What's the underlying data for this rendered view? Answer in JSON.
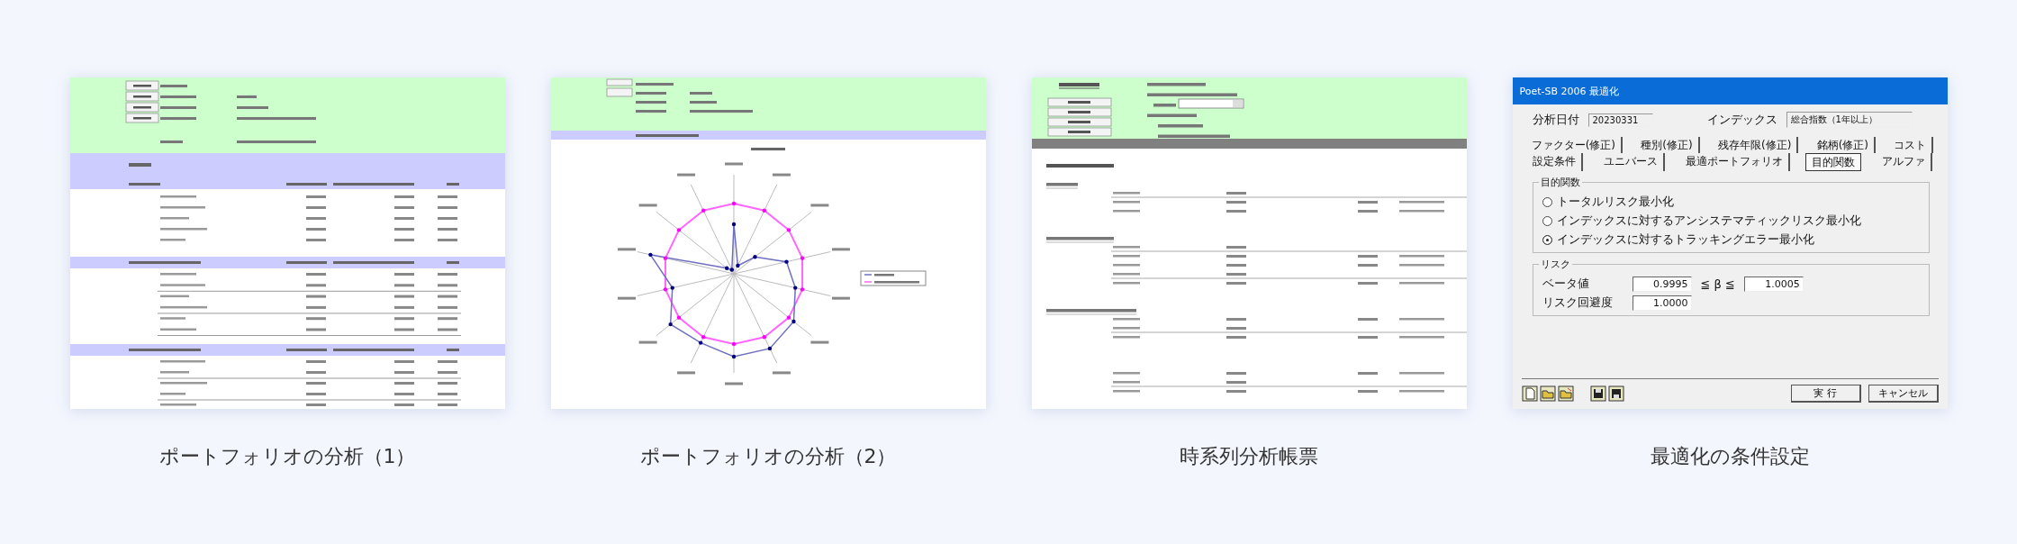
{
  "cards": [
    {
      "kind": "table-report",
      "caption": "ポートフォリオの分析（1）"
    },
    {
      "kind": "radar-report",
      "caption": "ポートフォリオの分析（2）"
    },
    {
      "kind": "timeseries-report",
      "caption": "時系列分析帳票"
    },
    {
      "kind": "dialog",
      "caption": "最適化の条件設定",
      "dialog": {
        "title": "Poet-SB 2006 最適化",
        "fields": [
          {
            "label": "分析日付",
            "value": "20230331"
          },
          {
            "label": "インデックス",
            "value": "総合指数（1年以上）"
          }
        ],
        "tab_rows": [
          [
            {
              "label": "ファクター(修正)",
              "selected": false
            },
            {
              "label": "種別(修正)",
              "selected": false
            },
            {
              "label": "残存年限(修正)",
              "selected": false
            },
            {
              "label": "銘柄(修正)",
              "selected": false
            },
            {
              "label": "コスト",
              "selected": false
            }
          ],
          [
            {
              "label": "設定条件",
              "selected": false
            },
            {
              "label": "ユニバース",
              "selected": false
            },
            {
              "label": "最適ポートフォリオ",
              "selected": false
            },
            {
              "label": "目的関数",
              "selected": true
            },
            {
              "label": "アルファ",
              "selected": false
            }
          ]
        ],
        "objective": {
          "label": "目的関数",
          "options": [
            {
              "label": "トータルリスク最小化",
              "selected": false
            },
            {
              "label": "インデックスに対するアンシステマティックリスク最小化",
              "selected": false
            },
            {
              "label": "インデックスに対するトラッキングエラー最小化",
              "selected": true
            }
          ]
        },
        "risk": {
          "label": "リスク",
          "beta_label": "ベータ値",
          "beta_min": "0.9995",
          "relation": "≦ β ≦",
          "beta_max": "1.0005",
          "aversion_label": "リスク回避度",
          "aversion": "1.0000"
        },
        "buttons": [
          "実 行",
          "キャンセル"
        ]
      }
    }
  ]
}
